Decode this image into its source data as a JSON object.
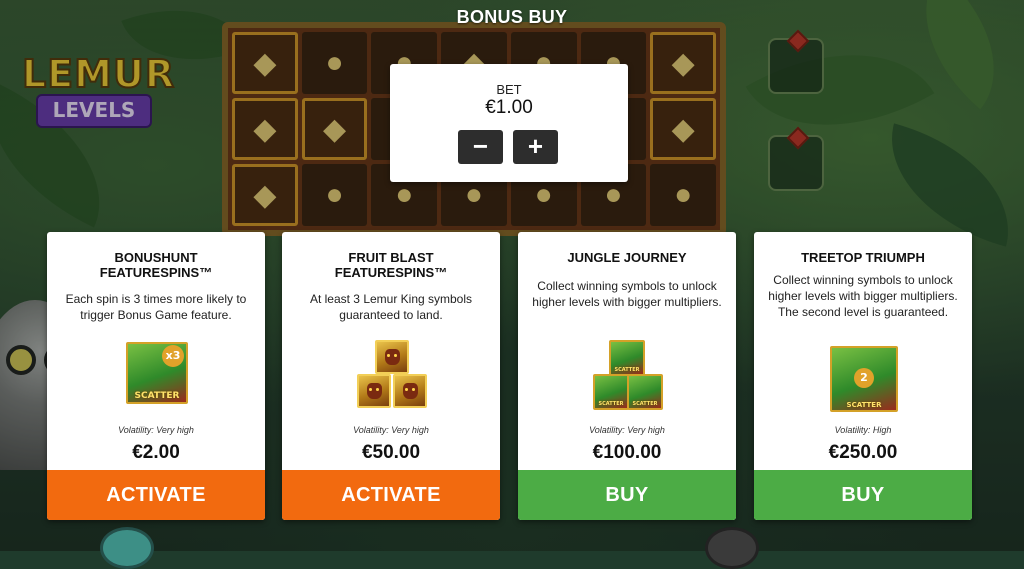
{
  "game": {
    "logo_line1": "LEMUR",
    "logo_line2": "LEVELS"
  },
  "dialog": {
    "title": "BONUS BUY",
    "bet": {
      "label": "BET",
      "value": "€1.00",
      "minus_label": "−",
      "plus_label": "+"
    }
  },
  "cards": [
    {
      "title": "BONUSHUNT FEATURESPINS™",
      "description": "Each spin is 3 times more likely to trigger Bonus Game feature.",
      "volatility": "Volatility: Very high",
      "price": "€2.00",
      "button": "ACTIVATE",
      "button_color": "#f26a0f",
      "image_multiplier": "x3",
      "image_text": "SCATTER"
    },
    {
      "title": "FRUIT BLAST FEATURESPINS™",
      "description": "At least 3 Lemur King symbols guaranteed to land.",
      "volatility": "Volatility: Very high",
      "price": "€50.00",
      "button": "ACTIVATE",
      "button_color": "#f26a0f"
    },
    {
      "title": "JUNGLE JOURNEY",
      "description": "Collect winning symbols to unlock higher levels with bigger multipliers.",
      "volatility": "Volatility: Very high",
      "price": "€100.00",
      "button": "BUY",
      "button_color": "#4cac45",
      "image_text": "SCATTER"
    },
    {
      "title": "TREETOP TRIUMPH",
      "description": "Collect winning symbols to unlock higher levels with bigger multipliers. The second level is guaranteed.",
      "volatility": "Volatility: High",
      "price": "€250.00",
      "button": "BUY",
      "button_color": "#4cac45",
      "image_multiplier": "2",
      "image_text": "SCATTER"
    }
  ]
}
